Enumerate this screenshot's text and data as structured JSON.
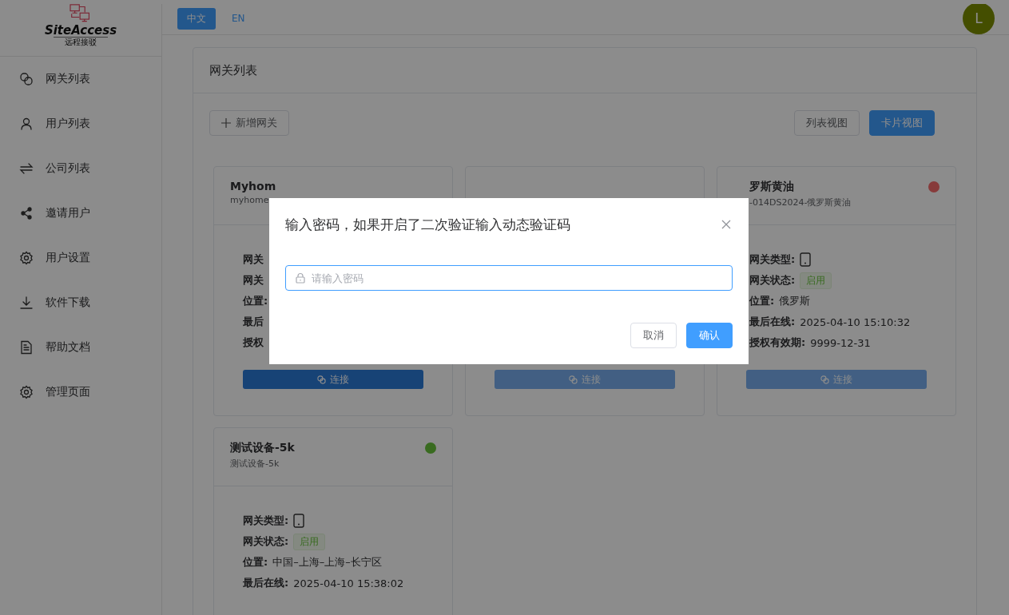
{
  "logo": {
    "name": "SiteAccess",
    "tagline": "远程接驳"
  },
  "languages": [
    {
      "label": "中文",
      "selected": true
    },
    {
      "label": "EN",
      "selected": false
    }
  ],
  "avatar": {
    "initial": "L"
  },
  "sidebar": {
    "items": [
      {
        "label": "网关列表"
      },
      {
        "label": "用户列表"
      },
      {
        "label": "公司列表"
      },
      {
        "label": "邀请用户"
      },
      {
        "label": "用户设置"
      },
      {
        "label": "软件下载"
      },
      {
        "label": "帮助文档"
      },
      {
        "label": "管理页面"
      }
    ]
  },
  "panel": {
    "title": "网关列表",
    "add_button": "新增网关",
    "views": [
      {
        "label": "列表视图",
        "selected": false
      },
      {
        "label": "卡片视图",
        "selected": true
      }
    ]
  },
  "cards": [
    {
      "title": "Myhom",
      "subtitle": "myhome",
      "rows": [
        {
          "label": "网关",
          "kind": "text"
        },
        {
          "label": "网关",
          "kind": "text"
        },
        {
          "label": "位置:",
          "kind": "text"
        },
        {
          "label": "最后",
          "kind": "text"
        },
        {
          "label": "授权",
          "kind": "text"
        }
      ],
      "connect": {
        "label": "连接",
        "disabled": false
      }
    },
    {
      "connect": {
        "label": "连接",
        "disabled": true
      }
    },
    {
      "title": "罗斯黄油",
      "subtitle": "-014DS2024-俄罗斯黄油",
      "color": "#873b3b",
      "rows": [
        {
          "label": "网关类型:",
          "kind": "type"
        },
        {
          "label": "网关状态:",
          "kind": "status",
          "value": "启用"
        },
        {
          "label": "位置:",
          "kind": "text",
          "value": "俄罗斯"
        },
        {
          "label": "最后在线:",
          "kind": "text",
          "value": "2025-04-10 15:10:32"
        },
        {
          "label": "授权有效期:",
          "kind": "text",
          "value": "9999-12-31"
        }
      ],
      "connect": {
        "label": "连接",
        "disabled": true
      }
    },
    {
      "title": "测试设备-5k",
      "subtitle": "测试设备-5k",
      "color": "#396b20",
      "rows": [
        {
          "label": "网关类型:",
          "kind": "type"
        },
        {
          "label": "网关状态:",
          "kind": "status",
          "value": "启用"
        },
        {
          "label": "位置:",
          "kind": "text",
          "value": "中国–上海–上海–长宁区"
        },
        {
          "label": "最后在线:",
          "kind": "text",
          "value": "2025-04-10 15:38:02"
        }
      ]
    }
  ],
  "dialog": {
    "title": "输入密码，如果开启了二次验证输入动态验证码",
    "input": {
      "placeholder": "请输入密码"
    },
    "buttons": [
      {
        "label": "取消",
        "kind": "default"
      },
      {
        "label": "确认",
        "kind": "primary"
      }
    ]
  }
}
